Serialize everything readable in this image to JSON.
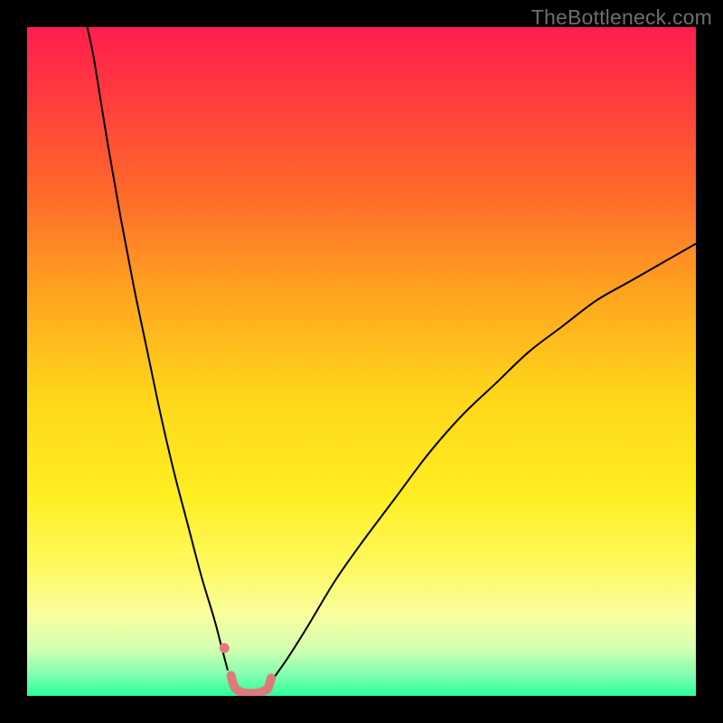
{
  "watermark": "TheBottleneck.com",
  "chart_data": {
    "type": "line",
    "title": "",
    "xlabel": "",
    "ylabel": "",
    "xlim": [
      0,
      100
    ],
    "ylim": [
      0,
      105
    ],
    "gradient_stops": [
      {
        "offset": 0.0,
        "color": "#ff1e4f"
      },
      {
        "offset": 0.1,
        "color": "#ff3a40"
      },
      {
        "offset": 0.25,
        "color": "#ff6a2a"
      },
      {
        "offset": 0.4,
        "color": "#ffa51f"
      },
      {
        "offset": 0.55,
        "color": "#ffd61a"
      },
      {
        "offset": 0.7,
        "color": "#ffee22"
      },
      {
        "offset": 0.8,
        "color": "#fff85a"
      },
      {
        "offset": 0.88,
        "color": "#f8ffa0"
      },
      {
        "offset": 0.93,
        "color": "#d4ffb0"
      },
      {
        "offset": 0.97,
        "color": "#7dffb0"
      },
      {
        "offset": 1.0,
        "color": "#2bff9a"
      }
    ],
    "series": [
      {
        "name": "left-branch",
        "stroke": "#000000",
        "stroke_width": 2,
        "x": [
          9,
          10,
          12,
          14,
          16,
          18,
          20,
          22,
          24,
          26,
          28,
          29,
          30
        ],
        "y": [
          105,
          100,
          87,
          75,
          64,
          54,
          44,
          35,
          27,
          19,
          12,
          8,
          4
        ]
      },
      {
        "name": "right-branch",
        "stroke": "#000000",
        "stroke_width": 2,
        "x": [
          37,
          39,
          42,
          46,
          50,
          55,
          60,
          65,
          70,
          75,
          80,
          85,
          90,
          95,
          100
        ],
        "y": [
          3,
          6,
          11,
          18,
          24,
          31,
          38,
          44,
          49,
          54,
          58,
          62,
          65,
          68,
          71
        ]
      },
      {
        "name": "floor-marker",
        "stroke": "#e07a7a",
        "stroke_width": 10,
        "linecap": "round",
        "x": [
          30.5,
          31,
          32,
          33,
          34,
          35,
          36,
          36.5
        ],
        "y": [
          3.2,
          1.4,
          0.6,
          0.4,
          0.4,
          0.6,
          1.2,
          2.8
        ]
      }
    ],
    "points": [
      {
        "name": "marker-dot",
        "x": 29.5,
        "y": 7.5,
        "r": 5.5,
        "fill": "#e07a7a"
      }
    ]
  }
}
